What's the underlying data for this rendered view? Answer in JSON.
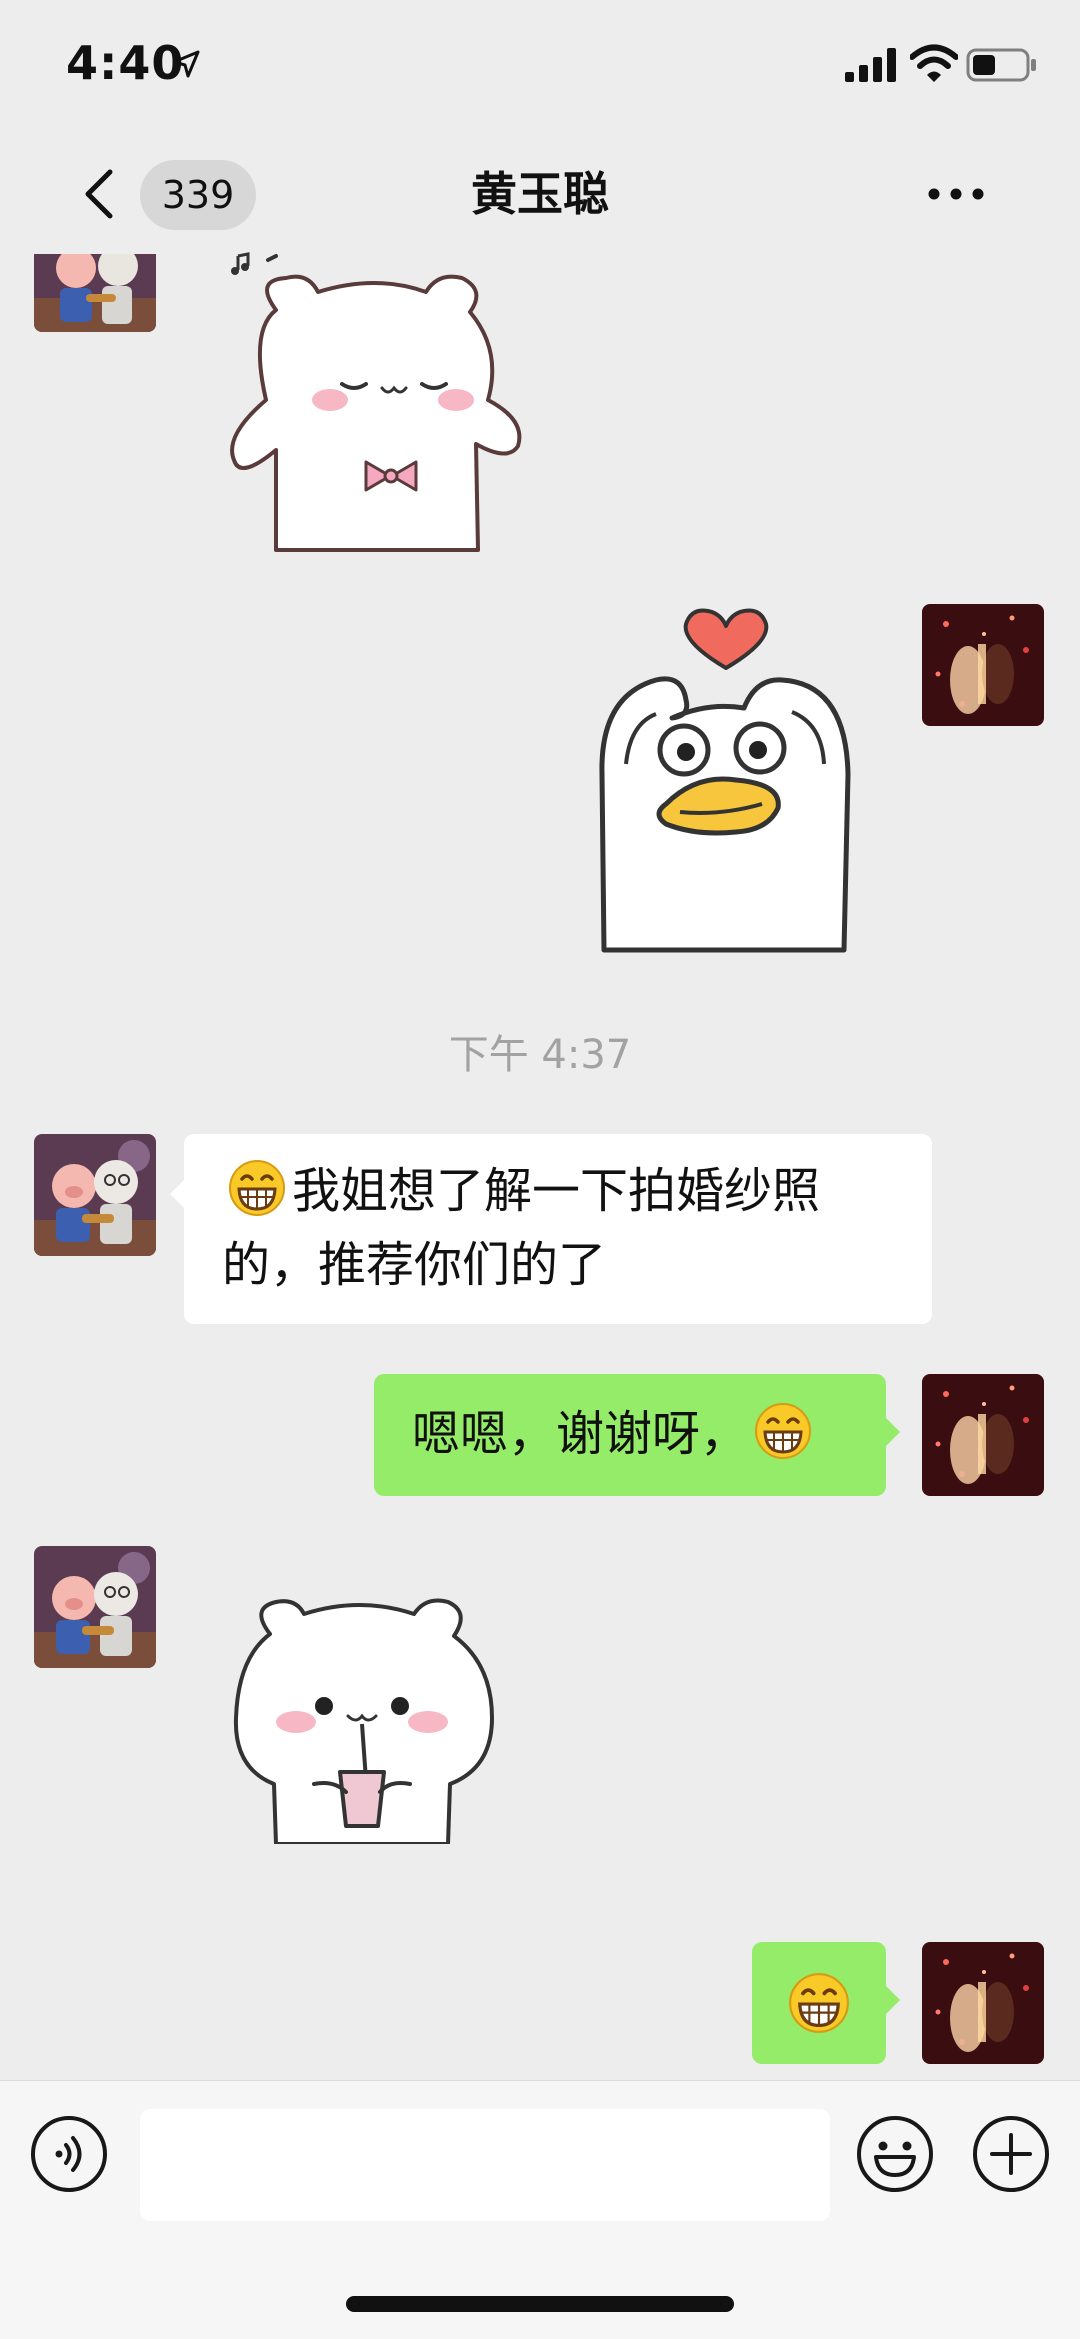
{
  "status_bar": {
    "time": "4:40"
  },
  "nav": {
    "unread_count": "339",
    "title": "黄玉聪"
  },
  "messages": {
    "timestamp": "下午 4:37",
    "incoming_text": "我姐想了解一下拍婚纱照的，推荐你们的了",
    "outgoing_text": "嗯嗯，谢谢呀，"
  },
  "colors": {
    "background": "#ededed",
    "outgoing_bubble": "#95ec69",
    "incoming_bubble": "#ffffff"
  },
  "icons": [
    "location-arrow-icon",
    "signal-icon",
    "wifi-icon",
    "battery-icon",
    "back-chevron-icon",
    "more-icon",
    "grin-emoji-icon",
    "voice-icon",
    "emoji-icon",
    "plus-icon"
  ]
}
